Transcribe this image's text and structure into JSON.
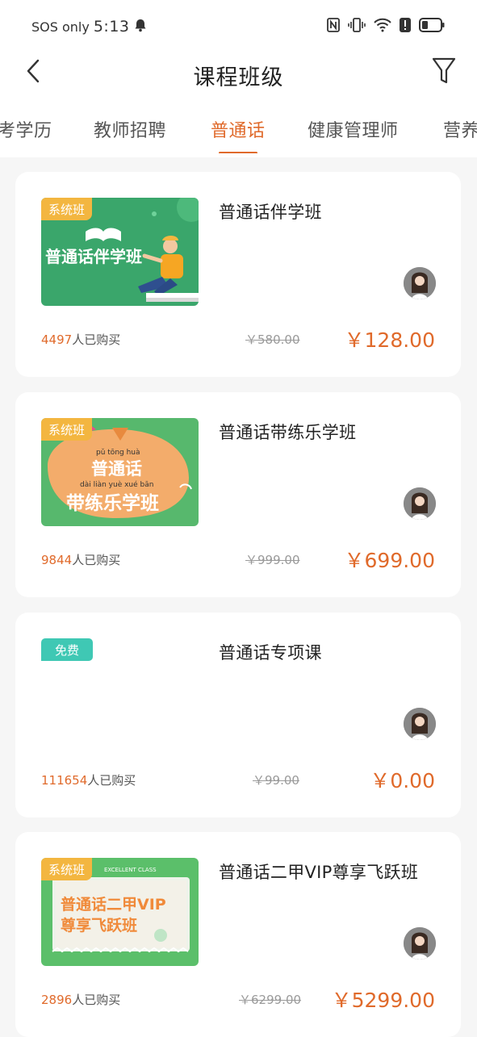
{
  "status_bar": {
    "carrier": "SOS only",
    "time": "5:13"
  },
  "header": {
    "title": "课程班级"
  },
  "tabs": [
    {
      "label": "考学历"
    },
    {
      "label": "教师招聘"
    },
    {
      "label": "普通话"
    },
    {
      "label": "健康管理师"
    },
    {
      "label": "营养"
    }
  ],
  "active_tab": "普通话",
  "courses": [
    {
      "title": "普通话伴学班",
      "badge": "系统班",
      "thumb_text": "普通话伴学班",
      "buyers_count": "4497",
      "buyers_suffix": "人已购买",
      "original_price": "￥580.00",
      "price": "￥128.00"
    },
    {
      "title": "普通话带练乐学班",
      "badge": "系统班",
      "thumb_text_line1": "普通话",
      "thumb_text_line2": "带练乐学班",
      "thumb_pinyin_1": "pǔ  tōng  huà",
      "thumb_pinyin_2": "dài   liàn   yuè   xué   bān",
      "buyers_count": "9844",
      "buyers_suffix": "人已购买",
      "original_price": "￥999.00",
      "price": "￥699.00"
    },
    {
      "title": "普通话专项课",
      "badge": "免费",
      "buyers_count": "111654",
      "buyers_suffix": "人已购买",
      "original_price": "￥99.00",
      "price": "￥0.00"
    },
    {
      "title": "普通话二甲VIP尊享飞跃班",
      "badge": "系统班",
      "thumb_header": "EXCELLENT CLASS",
      "thumb_text_line1": "普通话二甲VIP",
      "thumb_text_line2": "尊享飞跃班",
      "buyers_count": "2896",
      "buyers_suffix": "人已购买",
      "original_price": "￥6299.00",
      "price": "￥5299.00"
    }
  ],
  "colors": {
    "accent": "#e06a2b",
    "badge_system": "#f3b640",
    "badge_free": "#3fc8b4",
    "background": "#f6f6f6"
  },
  "icons": {
    "back": "chevron-left-icon",
    "filter": "filter-funnel-icon",
    "notification": "bell-icon",
    "nfc": "nfc-icon",
    "vibrate": "vibrate-icon",
    "wifi": "wifi-icon",
    "alert": "alert-icon",
    "battery": "battery-icon"
  }
}
